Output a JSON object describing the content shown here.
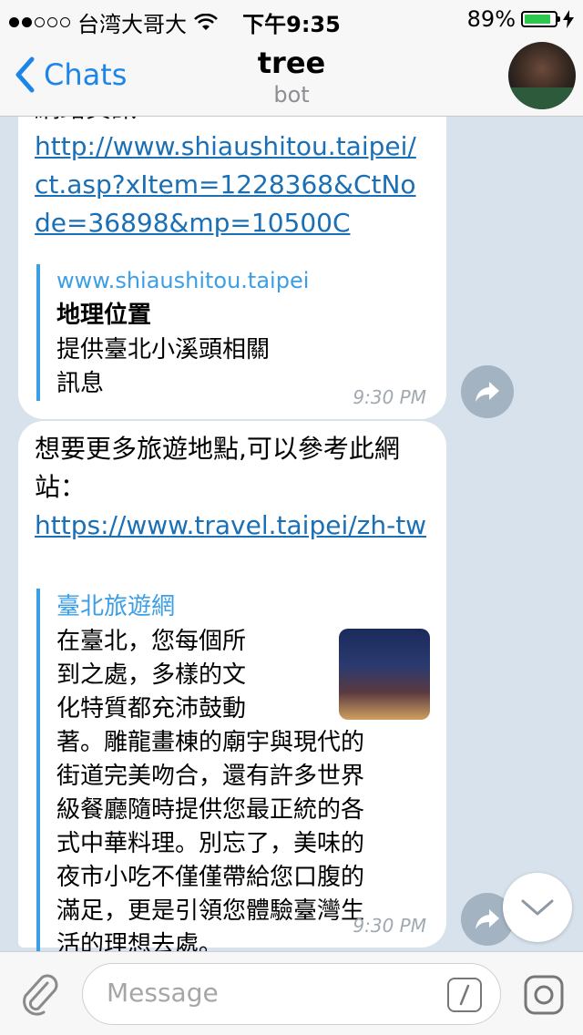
{
  "status_bar": {
    "signal_strength": 2,
    "carrier": "台湾大哥大",
    "wifi_icon": "wifi-icon",
    "time": "下午9:35",
    "battery_text": "89%",
    "battery_level": 0.89
  },
  "nav": {
    "back_label": "Chats",
    "title": "tree",
    "subtitle": "bot"
  },
  "messages": [
    {
      "text": "網路資訊:",
      "link": "http://www.shiaushitou.taipei/ct.asp?xItem=1228368&CtNode=36898&mp=10500C",
      "preview": {
        "site": "www.shiaushitou.taipei",
        "title": "地理位置",
        "desc": "提供臺北小溪頭相關訊息"
      },
      "time": "9:30 PM"
    },
    {
      "text": "想要更多旅遊地點,可以參考此網站：",
      "link": "https://www.travel.taipei/zh-tw",
      "preview": {
        "title": "臺北旅遊網",
        "desc": "在臺北，您每個所到之處，多樣的文化特質都充沛鼓動著。雕龍畫棟的廟宇與現代的街道完美吻合，還有許多世界級餐廳隨時提供您最正統的各式中華料理。別忘了，美味的夜市小吃不僅僅帶給您口腹的滿足，更是引領您體驗臺灣生活的理想去處。",
        "desc_lines": [
          "在臺北，您每個所",
          "到之處，多樣的文",
          "化特質都充沛鼓動",
          "著。雕龍畫棟的廟宇與現代的",
          "街道完美吻合，還有許多世界",
          "級餐廳隨時提供您最正統的各",
          "式中華料理。別忘了，美味的",
          "夜市小吃不僅僅帶給您口腹的",
          "滿足，更是引領您體驗臺灣生",
          "活的理想去處。"
        ]
      },
      "time": "9:30 PM"
    }
  ],
  "input": {
    "placeholder": "Message"
  },
  "colors": {
    "accent": "#1e85e8",
    "link": "#1a6fb5",
    "preview_bar": "#3c9ee5",
    "battery": "#2cc84d",
    "chat_background": "#d7e2ec"
  },
  "icons": [
    "wifi-icon",
    "back-chevron-icon",
    "share-icon",
    "chevron-down-icon",
    "paperclip-icon",
    "slash-command-icon",
    "camera-icon"
  ]
}
